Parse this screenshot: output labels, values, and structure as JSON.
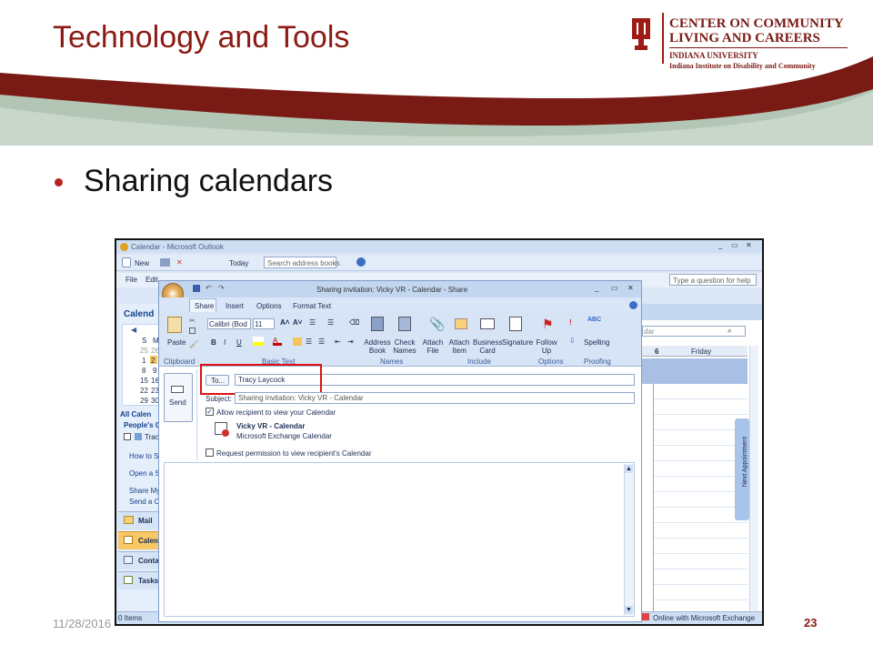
{
  "slide": {
    "title": "Technology and Tools",
    "bullet": "Sharing calendars",
    "date": "11/28/2016",
    "page": "23"
  },
  "logo": {
    "line1": "CENTER ON COMMUNITY",
    "line2": "LIVING AND CAREERS",
    "line3": "INDIANA UNIVERSITY",
    "line4": "Indiana Institute on Disability and Community"
  },
  "outlook": {
    "window_title": "Calendar - Microsoft Outlook",
    "toolbar": {
      "new": "New",
      "today": "Today",
      "search_placeholder": "Search address books"
    },
    "menu": [
      "File",
      "Edit"
    ],
    "help_placeholder": "Type a question for help",
    "calendar_header": "Calend",
    "mini_calendar": {
      "days": [
        "S",
        "M"
      ],
      "rows": [
        [
          "25",
          "26"
        ],
        [
          "1",
          "2"
        ],
        [
          "8",
          "9"
        ],
        [
          "15",
          "16"
        ],
        [
          "22",
          "23"
        ],
        [
          "29",
          "30"
        ]
      ]
    },
    "all_calendars": "All Calen",
    "peoples_calendars": "People's Ca",
    "shared_item": "Trac",
    "links": [
      "How to Sh",
      "Open a Sh",
      "Share My",
      "Send a Ca"
    ],
    "nav": [
      "Mail",
      "Calen",
      "Conta",
      "Tasks"
    ],
    "status_left": "0 Items",
    "status_right": "Online with Microsoft Exchange",
    "week": {
      "day_num": "6",
      "day_name": "Friday"
    },
    "search_right": "dar",
    "next_appointment": "Next Appointment"
  },
  "invite": {
    "window_title": "Sharing invitation: Vicky VR - Calendar - Share",
    "tabs": [
      "Share",
      "Insert",
      "Options",
      "Format Text"
    ],
    "font_name": "Calibri (Bod",
    "font_size": "11",
    "ribbon": {
      "paste": "Paste",
      "clipboard": "Clipboard",
      "basic_text": "Basic Text",
      "address_book": "Address Book",
      "check_names": "Check Names",
      "names": "Names",
      "attach_file": "Attach File",
      "attach_item": "Attach Item",
      "business_card": "Business Card",
      "signature": "Signature",
      "include": "Include",
      "follow_up": "Follow Up",
      "options": "Options",
      "spelling": "Spelling",
      "proofing": "Proofing",
      "abc": "ABC"
    },
    "send": "Send",
    "to_button": "To...",
    "to_value": "Tracy Laycock",
    "subject_label": "Subject:",
    "subject_value": "Sharing invitation: Vicky VR - Calendar",
    "allow_checkbox": "Allow recipient to view your Calendar",
    "calendar_name": "Vicky VR - Calendar",
    "calendar_type": "Microsoft Exchange Calendar",
    "request_checkbox": "Request permission to view recipient's Calendar"
  },
  "colors": {
    "title": "#8B1A14",
    "band_dark": "#7a1a14",
    "band_light": "#b9c9bb",
    "highlight": "#e01010",
    "ribbon": "#d6e4f5"
  }
}
